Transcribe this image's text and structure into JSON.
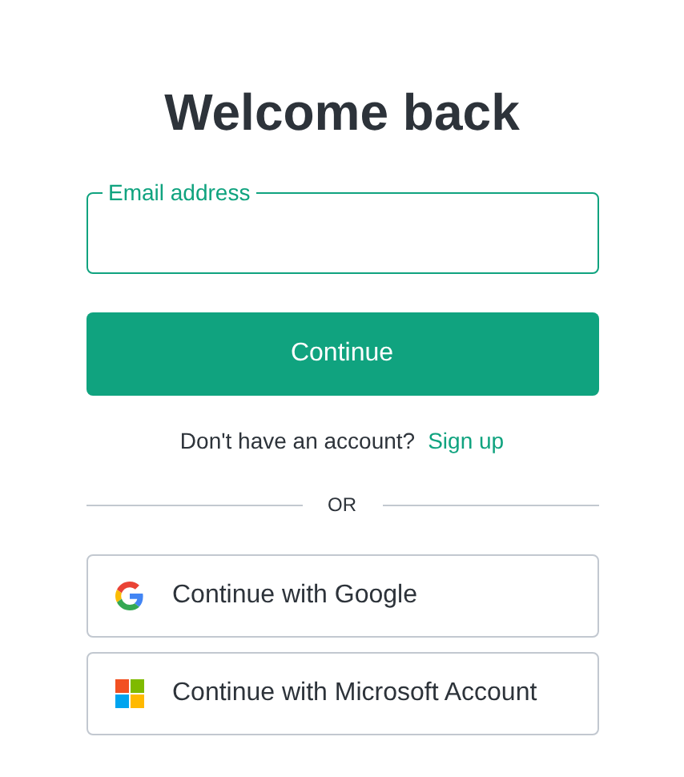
{
  "title": "Welcome back",
  "email_field": {
    "label": "Email address"
  },
  "continue_button": "Continue",
  "signup_prompt": {
    "text": "Don't have an account?",
    "link": "Sign up"
  },
  "divider": "OR",
  "social_buttons": [
    {
      "kind": "google",
      "label": "Continue with Google"
    },
    {
      "kind": "microsoft",
      "label": "Continue with Microsoft Account"
    }
  ]
}
